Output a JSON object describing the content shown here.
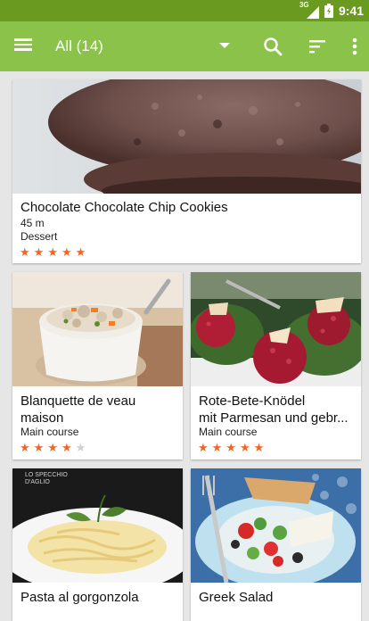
{
  "status": {
    "network": "3G",
    "time": "9:41"
  },
  "toolbar": {
    "filter_label": "All (14)"
  },
  "colors": {
    "appbar": "#8bc34a",
    "statusbar": "#6a9a1f",
    "star": "#f26522"
  },
  "recipes": [
    {
      "title": "Chocolate Chocolate Chip Cookies",
      "time": "45 m",
      "category": "Dessert",
      "rating": 5
    },
    {
      "title": "Blanquette de veau",
      "title_line2": "maison",
      "category": "Main course",
      "rating": 4
    },
    {
      "title": "Rote-Bete-Knödel",
      "title_line2": "mit Parmesan und gebr...",
      "category": "Main course",
      "rating": 5
    },
    {
      "title": "Pasta al gorgonzola",
      "image_caption": "LO SPECCHIO D'AGLIO"
    },
    {
      "title": "Greek Salad"
    }
  ]
}
